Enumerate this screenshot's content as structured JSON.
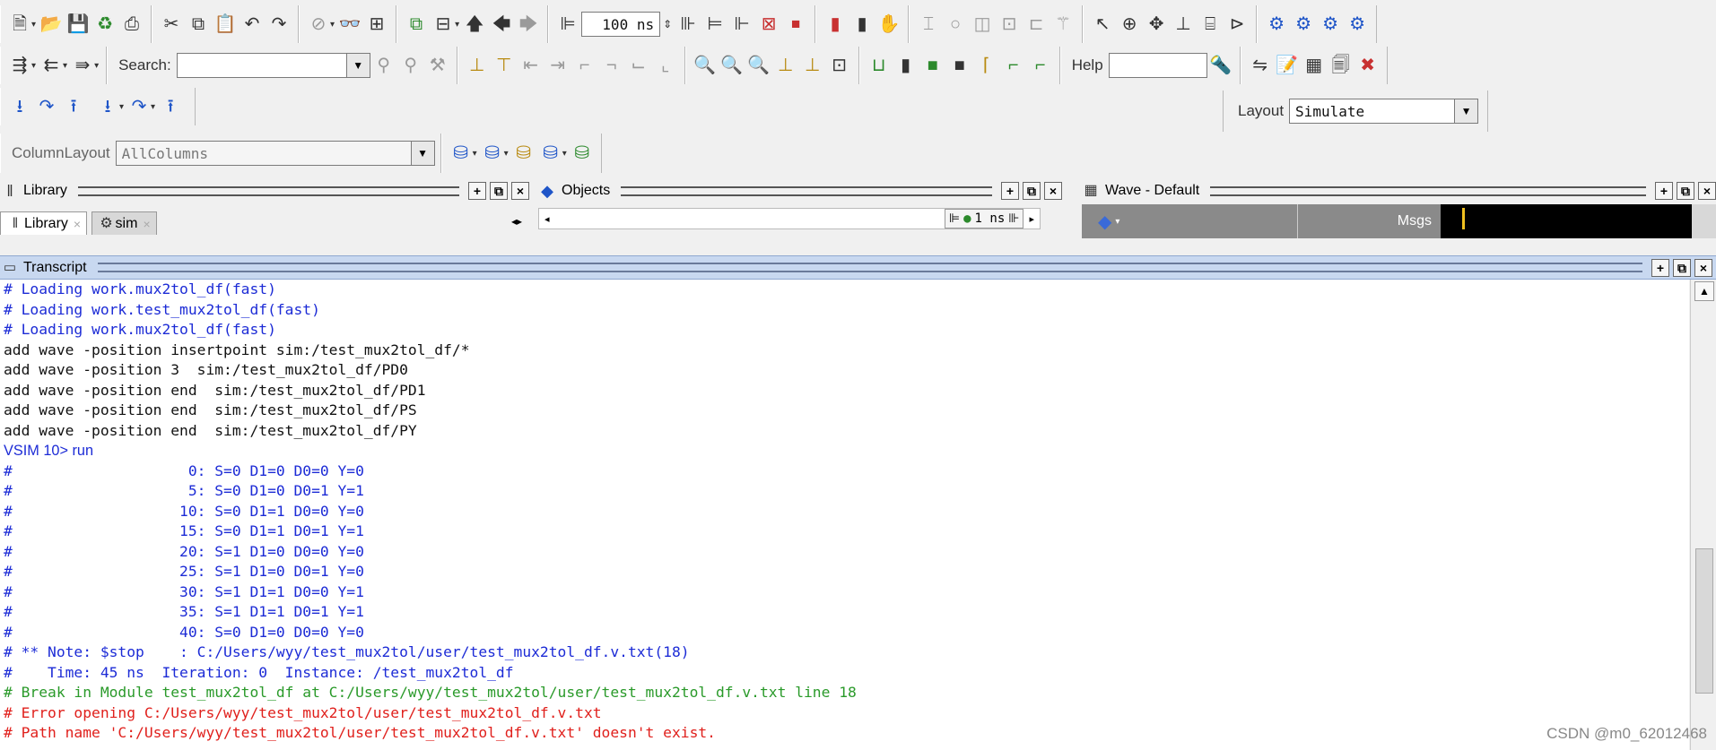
{
  "toolbar": {
    "time_value": "100 ns",
    "search_label": "Search:",
    "search_value": "",
    "help_label": "Help",
    "help_value": "",
    "layout_label": "Layout",
    "layout_value": "Simulate",
    "column_layout_label": "ColumnLayout",
    "column_layout_value": "AllColumns"
  },
  "panes": {
    "library_title": "Library",
    "objects_title": "Objects",
    "wave_title": "Wave - Default",
    "wave_msgs": "Msgs",
    "objects_time": "1 ns",
    "tabs": [
      {
        "label": "Library"
      },
      {
        "label": "sim"
      }
    ]
  },
  "transcript": {
    "title": "Transcript",
    "lines": [
      {
        "text": "# Loading work.mux2tol_df(fast)",
        "color": "#1c2bd6"
      },
      {
        "text": "# Loading work.test_mux2tol_df(fast)",
        "color": "#1c2bd6"
      },
      {
        "text": "# Loading work.mux2tol_df(fast)",
        "color": "#1c2bd6"
      },
      {
        "text": "add wave -position insertpoint sim:/test_mux2tol_df/*",
        "color": "#111111"
      },
      {
        "text": "add wave -position 3  sim:/test_mux2tol_df/PD0",
        "color": "#111111"
      },
      {
        "text": "add wave -position end  sim:/test_mux2tol_df/PD1",
        "color": "#111111"
      },
      {
        "text": "add wave -position end  sim:/test_mux2tol_df/PS",
        "color": "#111111"
      },
      {
        "text": "add wave -position end  sim:/test_mux2tol_df/PY",
        "color": "#111111"
      },
      {
        "text": "VSIM 10> run",
        "color": "#1c2bd6",
        "prompt": true
      },
      {
        "text": "#                    0: S=0 D1=0 D0=0 Y=0",
        "color": "#1c2bd6"
      },
      {
        "text": "#                    5: S=0 D1=0 D0=1 Y=1",
        "color": "#1c2bd6"
      },
      {
        "text": "#                   10: S=0 D1=1 D0=0 Y=0",
        "color": "#1c2bd6"
      },
      {
        "text": "#                   15: S=0 D1=1 D0=1 Y=1",
        "color": "#1c2bd6"
      },
      {
        "text": "#                   20: S=1 D1=0 D0=0 Y=0",
        "color": "#1c2bd6"
      },
      {
        "text": "#                   25: S=1 D1=0 D0=1 Y=0",
        "color": "#1c2bd6"
      },
      {
        "text": "#                   30: S=1 D1=1 D0=0 Y=1",
        "color": "#1c2bd6"
      },
      {
        "text": "#                   35: S=1 D1=1 D0=1 Y=1",
        "color": "#1c2bd6"
      },
      {
        "text": "#                   40: S=0 D1=0 D0=0 Y=0",
        "color": "#1c2bd6"
      },
      {
        "text": "# ** Note: $stop    : C:/Users/wyy/test_mux2tol/user/test_mux2tol_df.v.txt(18)",
        "color": "#1c2bd6"
      },
      {
        "text": "#    Time: 45 ns  Iteration: 0  Instance: /test_mux2tol_df",
        "color": "#1c2bd6"
      },
      {
        "text": "# Break in Module test_mux2tol_df at C:/Users/wyy/test_mux2tol/user/test_mux2tol_df.v.txt line 18",
        "color": "#2a9a2a"
      },
      {
        "text": "# Error opening C:/Users/wyy/test_mux2tol/user/test_mux2tol_df.v.txt",
        "color": "#e0201c"
      },
      {
        "text": "# Path name 'C:/Users/wyy/test_mux2tol/user/test_mux2tol_df.v.txt' doesn't exist.",
        "color": "#e0201c"
      }
    ]
  },
  "watermark": "CSDN @m0_62012468"
}
